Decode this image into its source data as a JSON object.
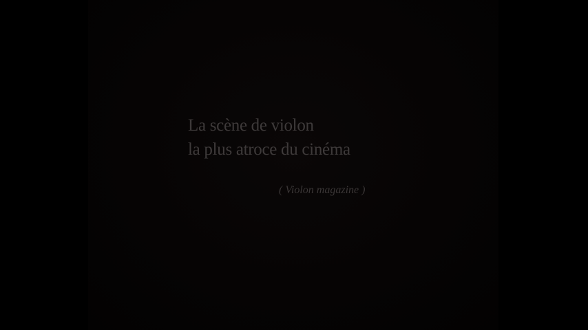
{
  "caption": {
    "line1": "La scène de violon",
    "line2": "la plus atroce du cinéma",
    "source": "( Violon magazine )"
  },
  "colors": {
    "background": "#000000",
    "text": "#3e3a3a"
  }
}
